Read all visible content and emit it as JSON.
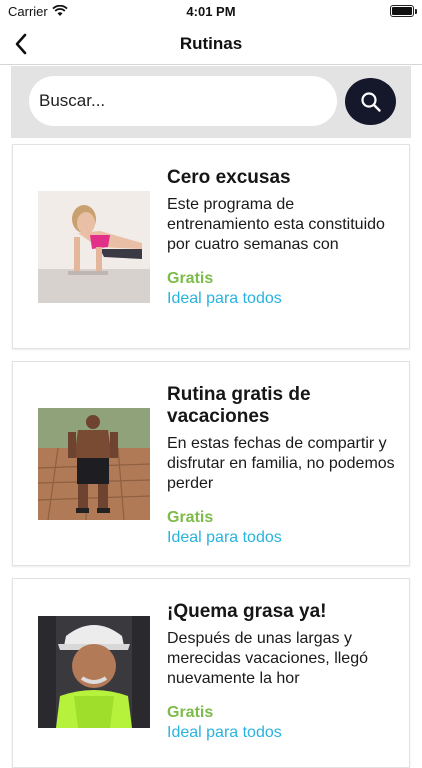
{
  "status_bar": {
    "carrier": "Carrier",
    "time": "4:01 PM"
  },
  "nav": {
    "title": "Rutinas"
  },
  "search": {
    "placeholder": "Buscar..."
  },
  "routines": [
    {
      "title": "Cero excusas",
      "description": "Este programa de entrenamiento esta constituido por cuatro semanas con",
      "price": "Gratis",
      "level": "Ideal para todos"
    },
    {
      "title": "Rutina gratis de vacaciones",
      "description": "En estas fechas de compartir y disfrutar en familia, no podemos perder",
      "price": "Gratis",
      "level": "Ideal para todos"
    },
    {
      "title": "¡Quema grasa ya!",
      "description": "Después de unas largas y merecidas vacaciones, llegó nuevamente la hor",
      "price": "Gratis",
      "level": "Ideal para todos"
    }
  ],
  "colors": {
    "price": "#7dbb4a",
    "level": "#28b3df",
    "search_button": "#15172b"
  }
}
